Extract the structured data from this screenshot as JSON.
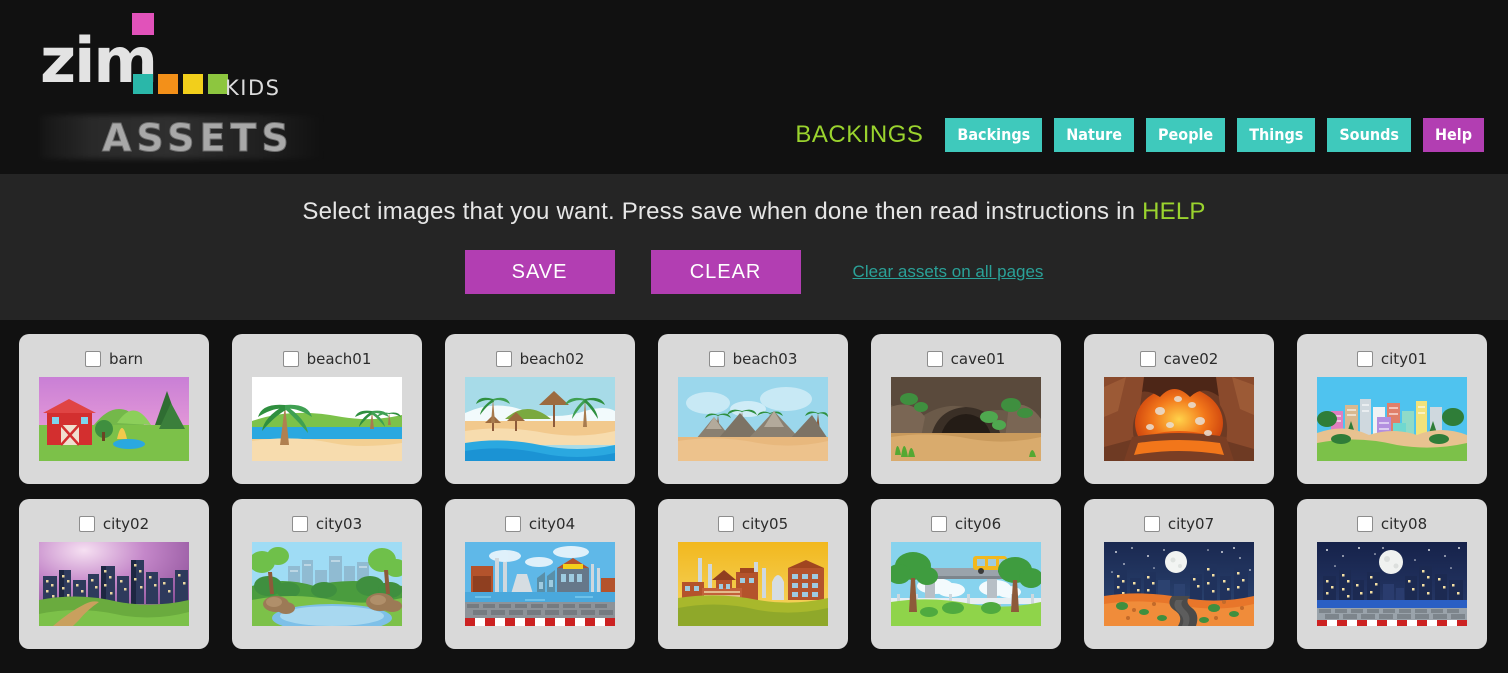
{
  "brand": {
    "logo_text": "zim",
    "logo_sub": "KIDS",
    "section_word": "ASSETS",
    "swatch_colors": [
      "#2ab7a9",
      "#f39019",
      "#f2cf1b",
      "#8dc63f"
    ],
    "pink_accent": "#e152ba"
  },
  "header": {
    "section_title": "BACKINGS",
    "section_title_color": "#9ad32e",
    "nav": [
      {
        "label": "Backings",
        "color": "#3fc9bc",
        "name": "nav-backings"
      },
      {
        "label": "Nature",
        "color": "#3fc9bc",
        "name": "nav-nature"
      },
      {
        "label": "People",
        "color": "#3fc9bc",
        "name": "nav-people"
      },
      {
        "label": "Things",
        "color": "#3fc9bc",
        "name": "nav-things"
      },
      {
        "label": "Sounds",
        "color": "#3fc9bc",
        "name": "nav-sounds"
      },
      {
        "label": "Help",
        "color": "#b23eb2",
        "name": "nav-help"
      }
    ]
  },
  "instructions": {
    "text_before": "Select images that you want. Press save when done then read instructions in ",
    "help_word": "HELP",
    "save_label": "SAVE",
    "clear_label": "CLEAR",
    "clear_all_link": "Clear assets on all pages",
    "link_color": "#2aa198",
    "button_color": "#b23eb2"
  },
  "grid": {
    "rows": [
      [
        {
          "label": "barn",
          "checked": false
        },
        {
          "label": "beach01",
          "checked": false
        },
        {
          "label": "beach02",
          "checked": false
        },
        {
          "label": "beach03",
          "checked": false
        },
        {
          "label": "cave01",
          "checked": false
        },
        {
          "label": "cave02",
          "checked": false
        },
        {
          "label": "city01",
          "checked": false
        }
      ],
      [
        {
          "label": "city02",
          "checked": false
        },
        {
          "label": "city03",
          "checked": false
        },
        {
          "label": "city04",
          "checked": false
        },
        {
          "label": "city05",
          "checked": false
        },
        {
          "label": "city06",
          "checked": false
        },
        {
          "label": "city07",
          "checked": false
        },
        {
          "label": "city08",
          "checked": false
        }
      ]
    ]
  }
}
